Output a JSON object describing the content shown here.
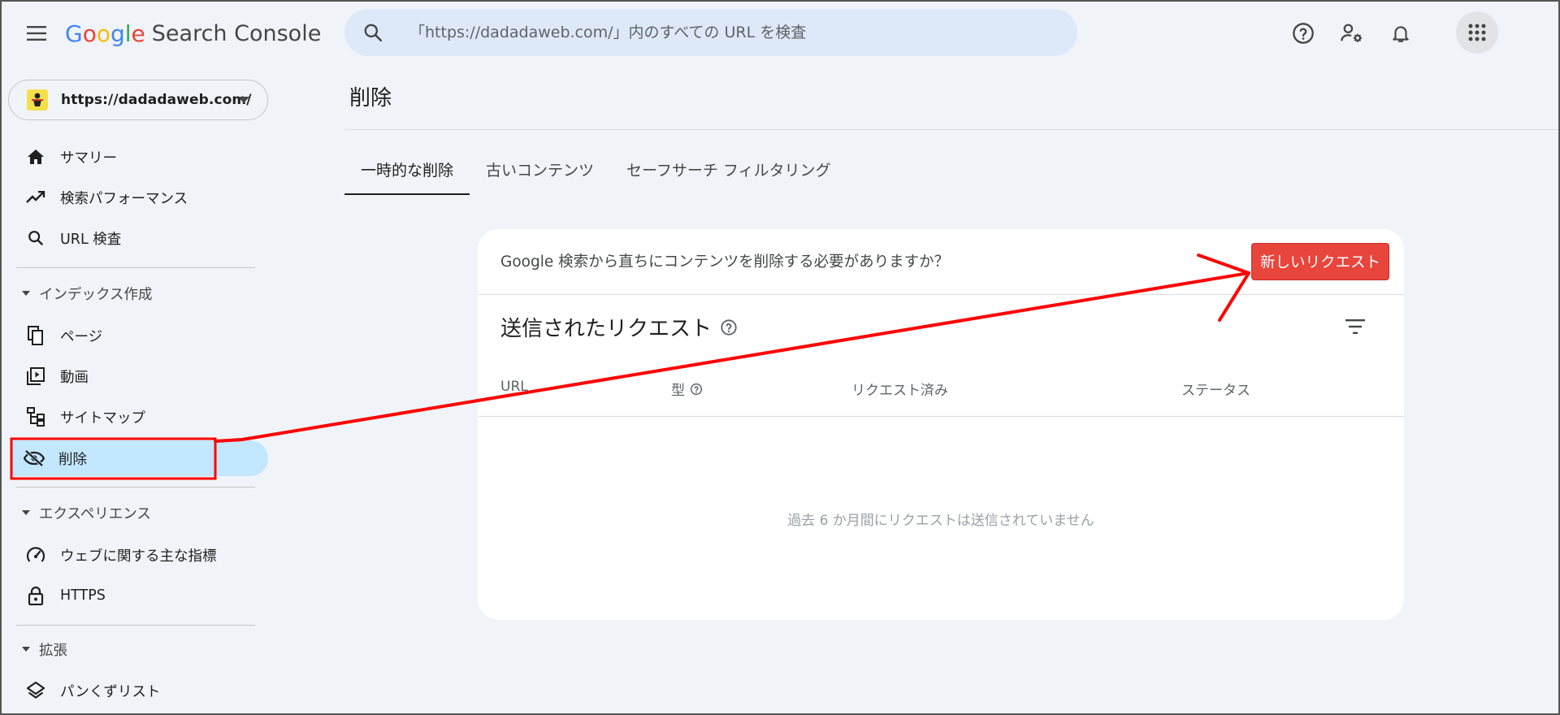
{
  "header": {
    "logo_letters": [
      "G",
      "o",
      "o",
      "g",
      "l",
      "e"
    ],
    "product": "Search Console",
    "search_placeholder": "「https://dadadaweb.com/」内のすべての URL を検査"
  },
  "sidebar": {
    "property": "https://dadadaweb.com/",
    "items_top": [
      {
        "label": "サマリー",
        "icon": "home-icon"
      },
      {
        "label": "検索パフォーマンス",
        "icon": "trending-up-icon"
      },
      {
        "label": "URL 検査",
        "icon": "search-icon"
      }
    ],
    "section_index": "インデックス作成",
    "items_index": [
      {
        "label": "ページ",
        "icon": "pages-icon"
      },
      {
        "label": "動画",
        "icon": "video-icon"
      },
      {
        "label": "サイトマップ",
        "icon": "sitemap-icon"
      },
      {
        "label": "削除",
        "icon": "eye-off-icon"
      }
    ],
    "section_experience": "エクスペリエンス",
    "items_experience": [
      {
        "label": "ウェブに関する主な指標",
        "icon": "speedometer-icon"
      },
      {
        "label": "HTTPS",
        "icon": "lock-icon"
      }
    ],
    "section_enhancements": "拡張",
    "items_enhancements": [
      {
        "label": "パンくずリスト",
        "icon": "layers-icon"
      }
    ]
  },
  "main": {
    "title": "削除",
    "tabs": [
      {
        "label": "一時的な削除",
        "active": true
      },
      {
        "label": "古いコンテンツ",
        "active": false
      },
      {
        "label": "セーフサーチ フィルタリング",
        "active": false
      }
    ],
    "card": {
      "question": "Google 検索から直ちにコンテンツを削除する必要がありますか？",
      "new_request_button": "新しいリクエスト",
      "requests_title": "送信されたリクエスト",
      "columns": [
        "URL",
        "型",
        "リクエスト済み",
        "ステータス"
      ],
      "empty_message": "過去 6 か月間にリクエストは送信されていません"
    }
  },
  "colors": {
    "accent_red": "#e8453c",
    "active_nav": "#c2e7ff",
    "annotation": "#ff0000"
  }
}
